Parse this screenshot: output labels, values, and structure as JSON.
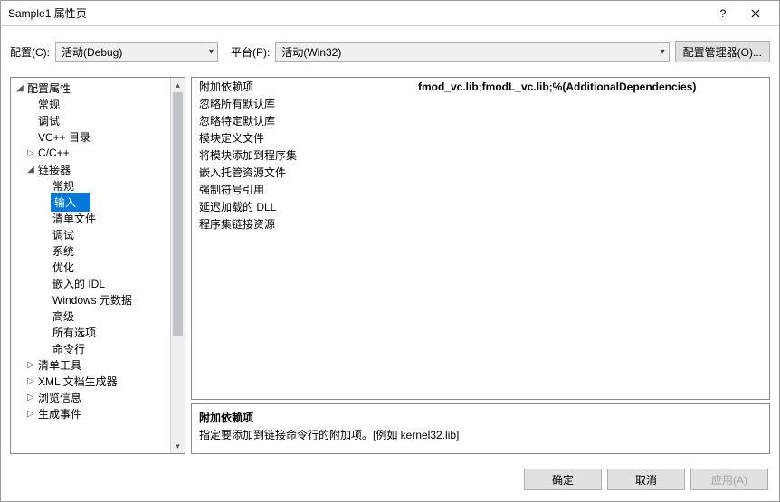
{
  "title": "Sample1 属性页",
  "toolbar": {
    "config_label": "配置(C):",
    "config_value": "活动(Debug)",
    "platform_label": "平台(P):",
    "platform_value": "活动(Win32)",
    "config_manager": "配置管理器(O)..."
  },
  "tree": {
    "root": "配置属性",
    "items": [
      {
        "label": "常规",
        "level": 1
      },
      {
        "label": "调试",
        "level": 1
      },
      {
        "label": "VC++ 目录",
        "level": 1
      },
      {
        "label": "C/C++",
        "level": 1,
        "expander": "▷"
      },
      {
        "label": "链接器",
        "level": 1,
        "expander": "◢"
      },
      {
        "label": "常规",
        "level": 2
      },
      {
        "label": "输入",
        "level": 2,
        "selected": true
      },
      {
        "label": "清单文件",
        "level": 2
      },
      {
        "label": "调试",
        "level": 2
      },
      {
        "label": "系统",
        "level": 2
      },
      {
        "label": "优化",
        "level": 2
      },
      {
        "label": "嵌入的 IDL",
        "level": 2
      },
      {
        "label": "Windows 元数据",
        "level": 2
      },
      {
        "label": "高级",
        "level": 2
      },
      {
        "label": "所有选项",
        "level": 2
      },
      {
        "label": "命令行",
        "level": 2
      },
      {
        "label": "清单工具",
        "level": 1,
        "expander": "▷"
      },
      {
        "label": "XML 文档生成器",
        "level": 1,
        "expander": "▷"
      },
      {
        "label": "浏览信息",
        "level": 1,
        "expander": "▷"
      },
      {
        "label": "生成事件",
        "level": 1,
        "expander": "▷"
      }
    ]
  },
  "properties": [
    {
      "name": "附加依赖项",
      "value": "fmod_vc.lib;fmodL_vc.lib;%(AdditionalDependencies)",
      "bold": true
    },
    {
      "name": "忽略所有默认库",
      "value": ""
    },
    {
      "name": "忽略特定默认库",
      "value": ""
    },
    {
      "name": "模块定义文件",
      "value": ""
    },
    {
      "name": "将模块添加到程序集",
      "value": ""
    },
    {
      "name": "嵌入托管资源文件",
      "value": ""
    },
    {
      "name": "强制符号引用",
      "value": ""
    },
    {
      "name": "延迟加载的 DLL",
      "value": ""
    },
    {
      "name": "程序集链接资源",
      "value": ""
    }
  ],
  "description": {
    "title": "附加依赖项",
    "text": "指定要添加到链接命令行的附加项。[例如 kernel32.lib]"
  },
  "buttons": {
    "ok": "确定",
    "cancel": "取消",
    "apply": "应用(A)"
  }
}
